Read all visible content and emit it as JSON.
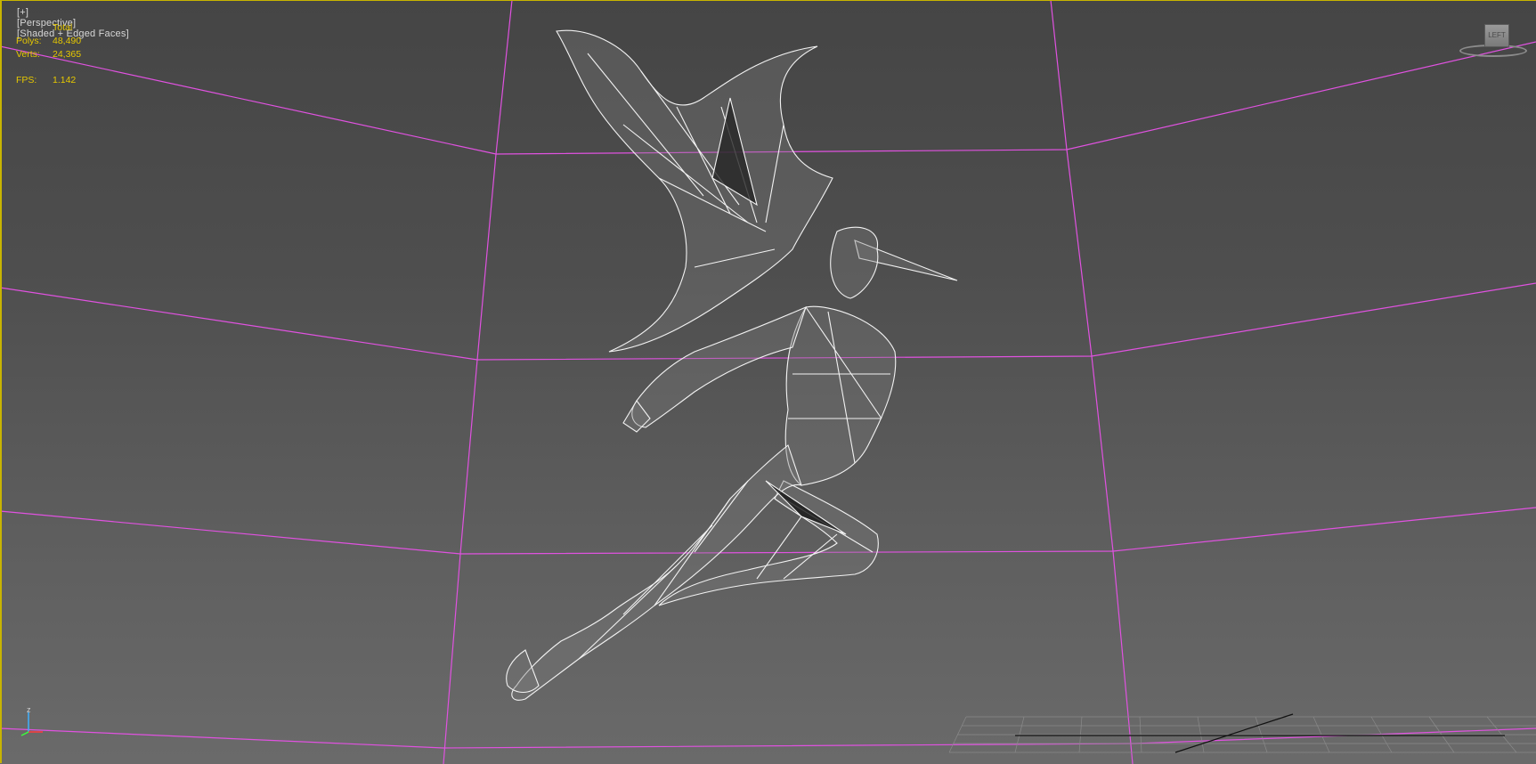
{
  "viewport": {
    "bracket_plus": "[+]",
    "view_name": "[Perspective]",
    "shading_mode": "[Shaded + Edged Faces]"
  },
  "stats": {
    "header": "Total",
    "polys_label": "Polys:",
    "polys_value": "48,490",
    "verts_label": "Verts:",
    "verts_value": "24,365",
    "fps_label": "FPS:",
    "fps_value": "1.142"
  },
  "viewcube": {
    "face_label": "LEFT"
  },
  "axis_tripod": {
    "z_label": "z"
  },
  "colors": {
    "grid_lines": "#e052e0",
    "stats_text": "#e6c800",
    "wireframe": "#f2f2f2",
    "viewport_border": "#c8b400"
  },
  "icons": {
    "viewcube": "viewcube-icon",
    "axis": "axis-tripod-icon"
  }
}
